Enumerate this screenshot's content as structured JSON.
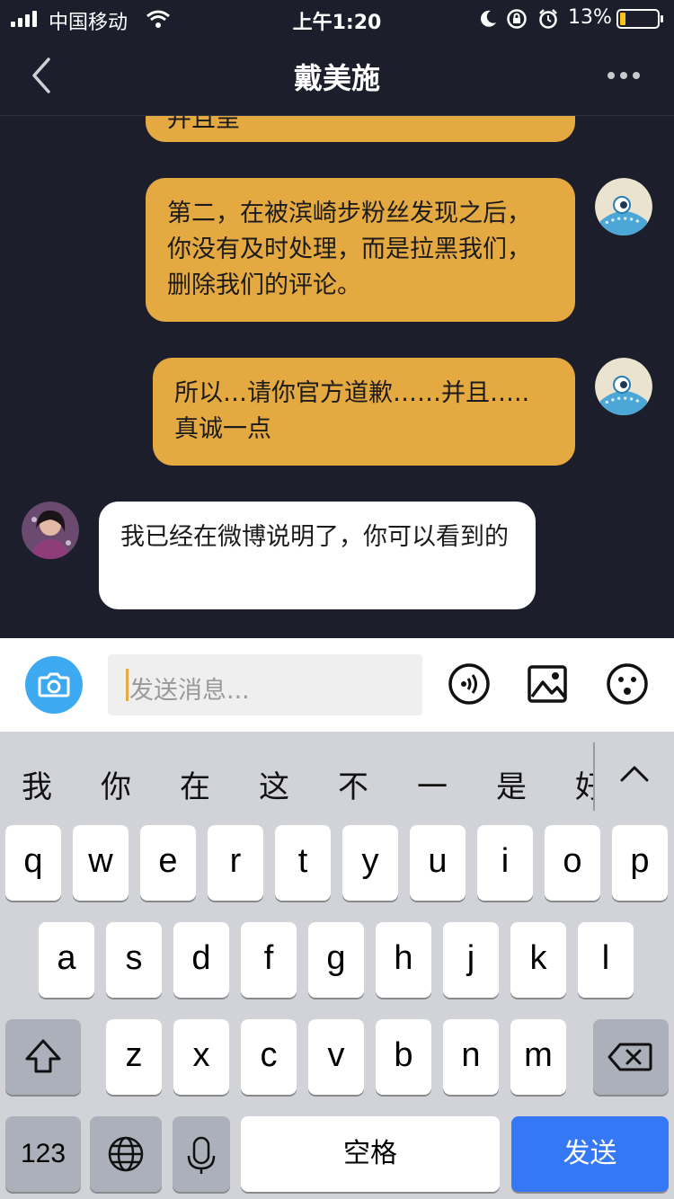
{
  "status": {
    "carrier": "中国移动",
    "time": "上午1:20",
    "battery_pct": "13%"
  },
  "nav": {
    "title": "戴美施"
  },
  "messages": [
    {
      "from": "me",
      "text": "并且呈"
    },
    {
      "from": "me",
      "text": "第二，在被滨崎步粉丝发现之后，你没有及时处理，而是拉黑我们，删除我们的评论。"
    },
    {
      "from": "me",
      "text": "所以…请你官方道歉……并且…..真诚一点"
    },
    {
      "from": "them",
      "text": "我已经在微博说明了，你可以看到的"
    }
  ],
  "input": {
    "placeholder": "发送消息..."
  },
  "keyboard": {
    "candidates": [
      "我",
      "你",
      "在",
      "这",
      "不",
      "一",
      "是",
      "好"
    ],
    "row1": [
      "q",
      "w",
      "e",
      "r",
      "t",
      "y",
      "u",
      "i",
      "o",
      "p"
    ],
    "row2": [
      "a",
      "s",
      "d",
      "f",
      "g",
      "h",
      "j",
      "k",
      "l"
    ],
    "row3": [
      "z",
      "x",
      "c",
      "v",
      "b",
      "n",
      "m"
    ],
    "numbers_label": "123",
    "space_label": "空格",
    "send_label": "发送"
  },
  "colors": {
    "bg": "#1c1e2b",
    "my_bubble": "#e5a942",
    "their_bubble": "#ffffff",
    "send_key": "#3478f6",
    "camera": "#3da9f0"
  }
}
